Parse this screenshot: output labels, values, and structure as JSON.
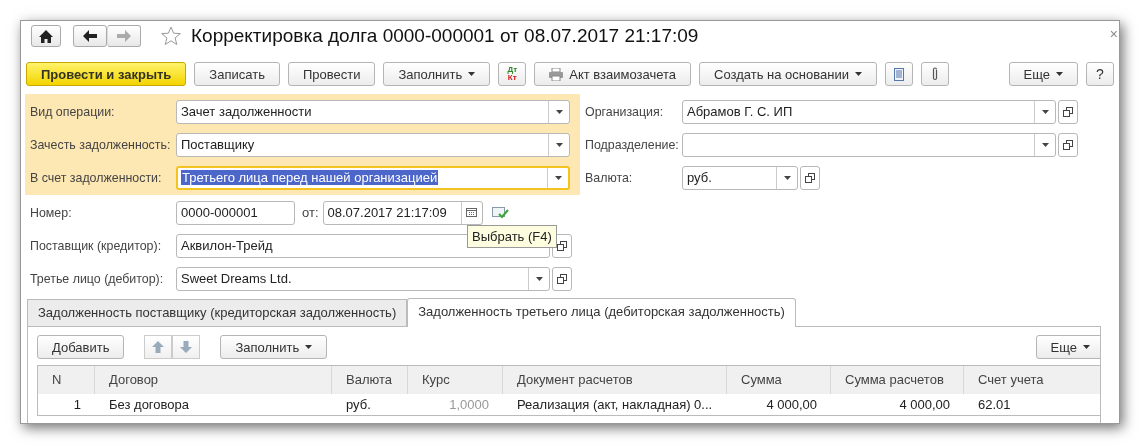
{
  "window": {
    "title": "Корректировка долга 0000-000001 от 08.07.2017 21:17:09",
    "close": "×"
  },
  "toolbar": [
    {
      "kind": "primary",
      "label": "Провести и закрыть"
    },
    {
      "kind": "button",
      "label": "Записать"
    },
    {
      "kind": "button",
      "label": "Провести"
    },
    {
      "kind": "dropdown",
      "label": "Заполнить"
    },
    {
      "kind": "dtkt",
      "label": "Дт",
      "label2": "Кт"
    },
    {
      "kind": "print",
      "label": "Акт взаимозачета"
    },
    {
      "kind": "dropdown",
      "label": "Создать на основании"
    },
    {
      "kind": "report"
    },
    {
      "kind": "attach"
    },
    {
      "kind": "more",
      "label": "Еще"
    },
    {
      "kind": "help",
      "label": "?"
    }
  ],
  "main_fields": [
    {
      "label": "Вид операции:",
      "value": "Зачет задолженности",
      "focused": false
    },
    {
      "label": "Зачесть задолженность:",
      "value": "Поставщику",
      "focused": false
    },
    {
      "label": "В счет задолженности:",
      "value": "Третьего лица перед нашей организацией",
      "focused": true
    }
  ],
  "right_fields": [
    {
      "label": "Организация:",
      "value": "Абрамов Г. С. ИП",
      "kind": "wide"
    },
    {
      "label": "Подразделение:",
      "kind": "wide"
    },
    {
      "label": "Валюта:",
      "value": "руб.",
      "kind": "short"
    }
  ],
  "number": {
    "label": "Номер:",
    "value": "0000-000001",
    "date_label": "от:",
    "date": "08.07.2017 21:17:09"
  },
  "parties": [
    {
      "label": "Поставщик (кредитор):",
      "value": "Аквилон-Трейд",
      "dropdown": false
    },
    {
      "label": "Третье лицо (дебитор):",
      "value": "Sweet Dreams Ltd.",
      "dropdown": true
    }
  ],
  "tooltip": "Выбрать (F4)",
  "tabs": [
    {
      "label": "Задолженность поставщику (кредиторская задолженность)",
      "selected": false
    },
    {
      "label": "Задолженность третьего лица (дебиторская задолженность)",
      "selected": true
    }
  ],
  "table_toolbar": {
    "add": "Добавить",
    "fill": "Заполнить",
    "more": "Еще"
  },
  "table": {
    "columns": [
      "N",
      "Договор",
      "Валюта",
      "Курс",
      "Документ расчетов",
      "Сумма",
      "Сумма расчетов",
      "Счет учета"
    ],
    "rows": [
      [
        "1",
        "Без договора",
        "руб.",
        "1,0000",
        "Реализация (акт, накладная) 0...",
        "4 000,00",
        "4 000,00",
        "62.01"
      ]
    ]
  }
}
